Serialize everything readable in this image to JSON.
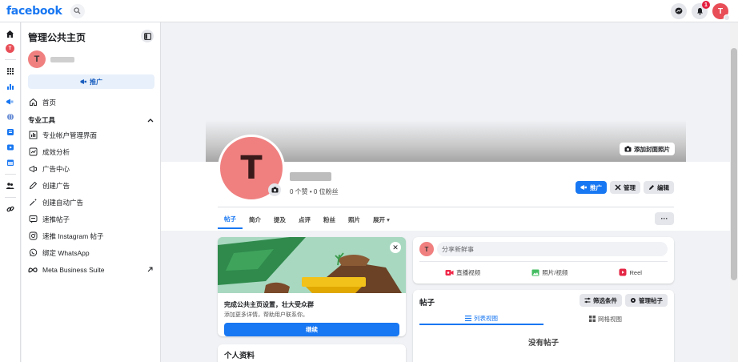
{
  "topbar": {
    "logo": "facebook",
    "notification_count": "1",
    "avatar_letter": "T"
  },
  "rail": {
    "avatar_letter": "T"
  },
  "sidebar": {
    "title": "管理公共主页",
    "page_avatar_letter": "T",
    "promote_label": "推广",
    "home_label": "首页",
    "section_label": "专业工具",
    "items": [
      {
        "label": "专业帐户管理界面",
        "icon": "dashboard-icon"
      },
      {
        "label": "成效分析",
        "icon": "insights-icon"
      },
      {
        "label": "广告中心",
        "icon": "megaphone-icon"
      },
      {
        "label": "创建广告",
        "icon": "pencil-icon"
      },
      {
        "label": "创建自动广告",
        "icon": "magic-wand-icon"
      },
      {
        "label": "速推帖子",
        "icon": "boost-post-icon"
      },
      {
        "label": "速推 Instagram 帖子",
        "icon": "instagram-icon"
      },
      {
        "label": "绑定 WhatsApp",
        "icon": "whatsapp-icon"
      },
      {
        "label": "Meta Business Suite",
        "icon": "meta-icon"
      }
    ]
  },
  "cover": {
    "add_cover_label": "添加封面照片"
  },
  "profile": {
    "avatar_letter": "T",
    "stats": "0 个赞 • 0 位粉丝",
    "promote_label": "推广",
    "manage_label": "管理",
    "edit_label": "编辑",
    "more_label": "···"
  },
  "tabs": [
    {
      "label": "帖子"
    },
    {
      "label": "简介"
    },
    {
      "label": "提及"
    },
    {
      "label": "点评"
    },
    {
      "label": "粉丝"
    },
    {
      "label": "照片"
    },
    {
      "label": "展开 ▾"
    }
  ],
  "setup_card": {
    "title": "完成公共主页设置，壮大受众群",
    "subtitle": "添加更多详情，帮助用户联系你。",
    "button_label": "继续",
    "close_label": "✕"
  },
  "info_card": {
    "title": "个人资料"
  },
  "composer": {
    "avatar_letter": "T",
    "placeholder": "分享新鲜事",
    "actions": [
      {
        "label": "直播视频",
        "color": "#f02849"
      },
      {
        "label": "照片/视频",
        "color": "#45bd62"
      },
      {
        "label": "Reel",
        "color": "#e42645"
      }
    ]
  },
  "posts": {
    "title": "帖子",
    "filter_label": "筛选条件",
    "manage_label": "管理帖子",
    "list_view_label": "列表视图",
    "grid_view_label": "网格视图",
    "empty_label": "没有帖子"
  },
  "colors": {
    "brand": "#1877f2",
    "avatar": "#f08080"
  }
}
